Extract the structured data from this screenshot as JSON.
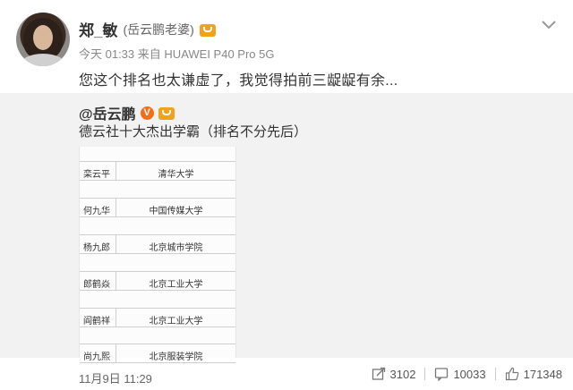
{
  "author": {
    "name": "郑_敏",
    "remark": "(岳云鹏老婆)",
    "time": "今天 01:33",
    "source_prefix": "来自",
    "device": "HUAWEI P40 Pro 5G"
  },
  "post_text": "您这个排名也太谦虚了，我觉得拍前三龊龊有余...",
  "repost": {
    "handle": "@岳云鹏",
    "verified_mark": "V",
    "text": "德云社十大杰出学霸（排名不分先后）",
    "rows": [
      {
        "name": "栾云平",
        "school": "清华大学"
      },
      {
        "name": "何九华",
        "school": "中国传媒大学"
      },
      {
        "name": "杨九郎",
        "school": "北京城市学院"
      },
      {
        "name": "郎鹤焱",
        "school": "北京工业大学"
      },
      {
        "name": "阎鹤祥",
        "school": "北京工业大学"
      },
      {
        "name": "尚九熙",
        "school": "北京服装学院"
      }
    ]
  },
  "footer": {
    "date": "11月9日 11:29",
    "reposts": "3102",
    "comments": "10033",
    "likes": "171348"
  },
  "icons": {
    "badge": "crown-badge-icon",
    "menu": "chevron-down-icon",
    "repost": "repost-icon",
    "comment": "comment-icon",
    "like": "like-icon"
  },
  "colors": {
    "repost_bg": "#f2f2f2",
    "badge": "#f2a11b",
    "verified": "#f36e18"
  }
}
